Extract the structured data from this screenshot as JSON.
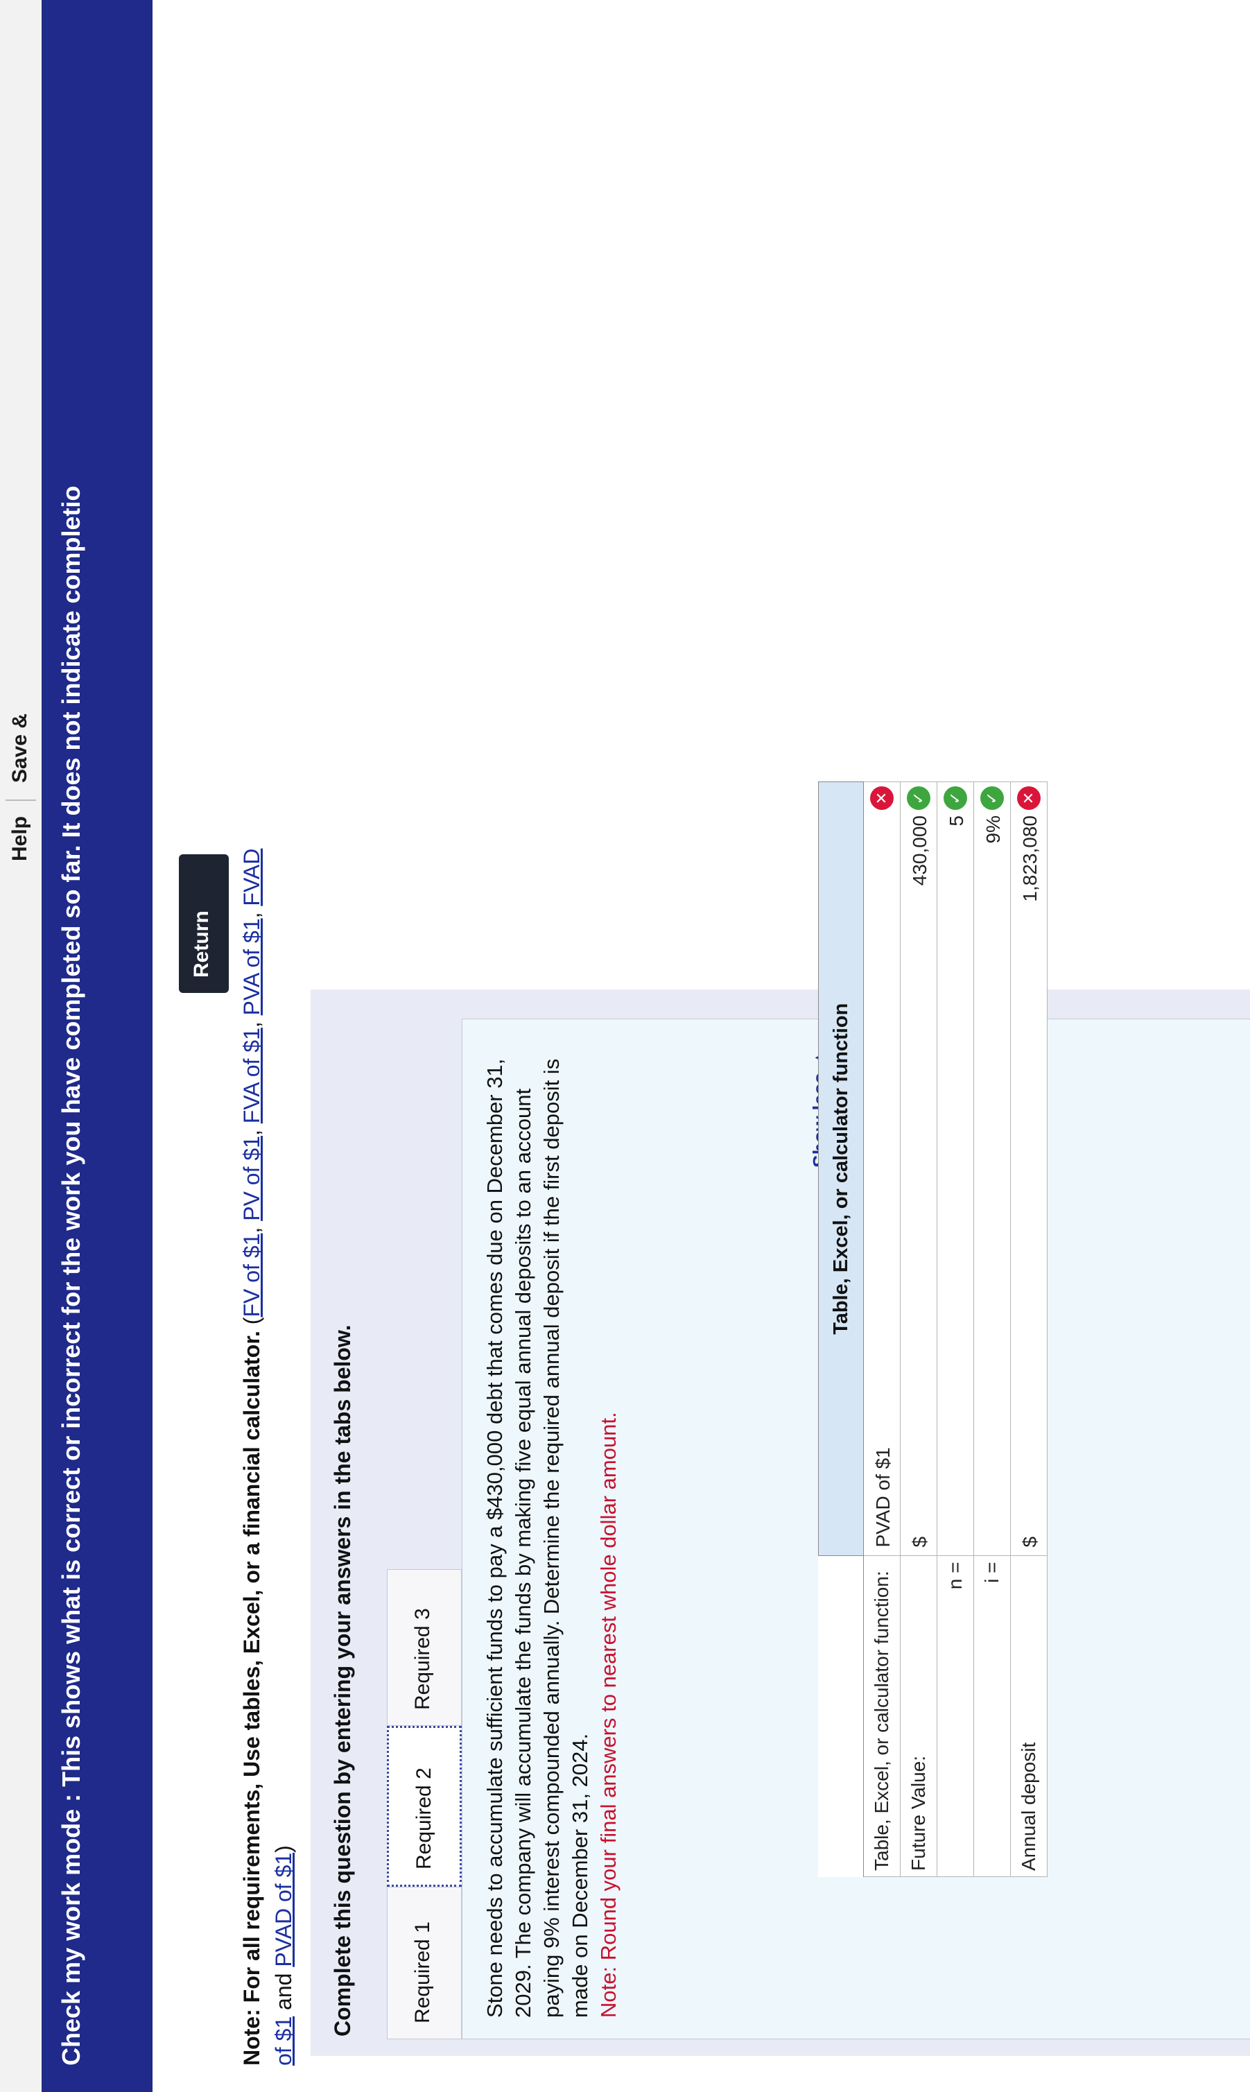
{
  "topbar": {
    "help": "Help",
    "save": "Save &"
  },
  "banner": {
    "text": "Check my work mode : This shows what is correct or incorrect for the work you have completed so far. It does not indicate completio"
  },
  "return_button": "Return",
  "note": {
    "lead": "Note: For all requirements, Use tables, Excel, or a financial calculator.",
    "links": [
      "FV of $1",
      "PV of $1",
      "FVA of $1",
      "PVA of $1",
      "FVAD of $1",
      "PVAD of $1"
    ],
    "and": "and",
    "open_paren": "(",
    "close_paren": ")"
  },
  "panel": {
    "title": "Complete this question by entering your answers in the tabs below.",
    "tabs": [
      {
        "label": "Required 1",
        "active": false
      },
      {
        "label": "Required 2",
        "active": true
      },
      {
        "label": "Required 3",
        "active": false
      }
    ],
    "question": "Stone needs to accumulate sufficient funds to pay a $430,000 debt that comes due on December 31, 2029. The company will accumulate the funds by making five equal annual deposits to an account paying 9% interest compounded annually. Determine the required annual deposit if the first deposit is made on December 31, 2024.",
    "rounding_note": "Note: Round your final answers to nearest whole dollar amount.",
    "show_less": "Show less ▲"
  },
  "answer_table": {
    "header": "Table, Excel, or calculator function",
    "rows": [
      {
        "label": "Table, Excel, or calculator function:",
        "currency": "",
        "value": "PVAD of $1",
        "status": "incorrect",
        "value_align": "left"
      },
      {
        "label": "Future Value:",
        "currency": "$",
        "value": "430,000",
        "status": "correct"
      },
      {
        "label": "n =",
        "currency": "",
        "value": "5",
        "status": "correct"
      },
      {
        "label": "i =",
        "currency": "",
        "value": "9%",
        "status": "correct"
      },
      {
        "label": "Annual deposit",
        "currency": "$",
        "value": "1,823,080",
        "status": "incorrect"
      }
    ]
  },
  "colors": {
    "banner": "#1f2a8a",
    "link": "#1b2fa0",
    "correct": "#3ea63e",
    "incorrect": "#d9163a",
    "panel": "#e8ebf6"
  },
  "icons": {
    "correct": "check-circle-icon",
    "incorrect": "x-circle-icon"
  }
}
